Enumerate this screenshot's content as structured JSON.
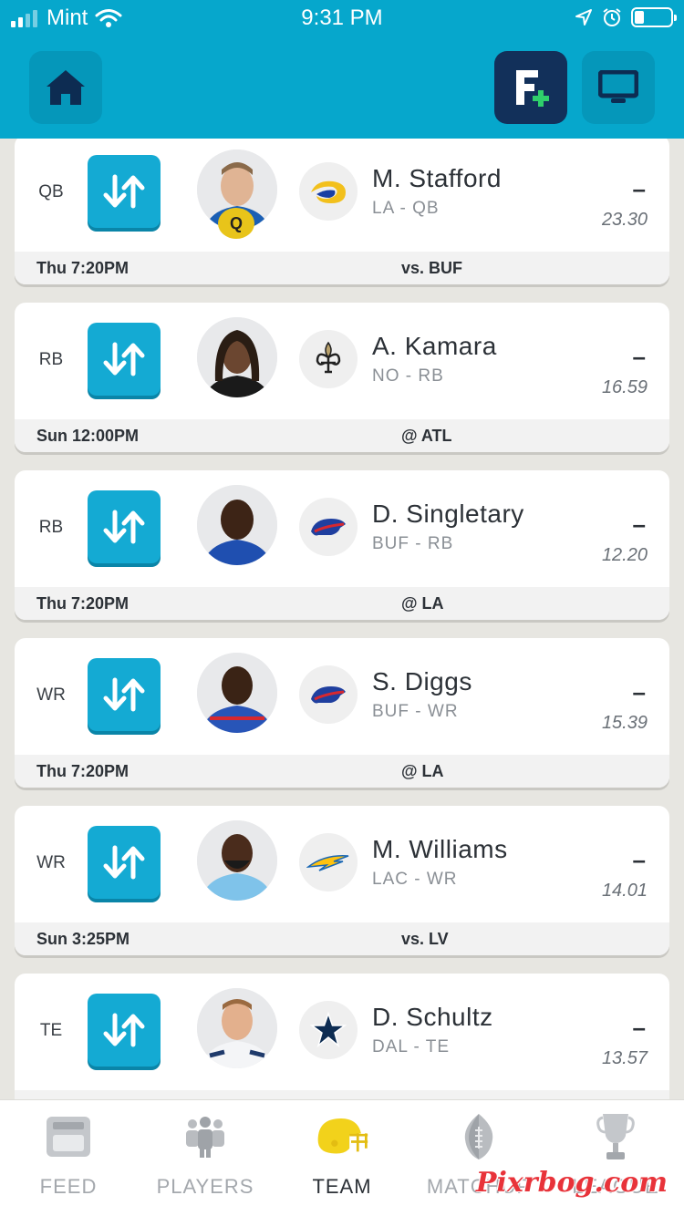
{
  "status": {
    "carrier": "Mint",
    "time": "9:31 PM"
  },
  "players": [
    {
      "pos": "QB",
      "name": "M. Stafford",
      "team": "LA - QB",
      "score": "–",
      "proj": "23.30",
      "game_time": "Thu 7:20PM",
      "opponent": "vs. BUF",
      "badge": "Q",
      "logo": "rams-logo"
    },
    {
      "pos": "RB",
      "name": "A. Kamara",
      "team": "NO - RB",
      "score": "–",
      "proj": "16.59",
      "game_time": "Sun 12:00PM",
      "opponent": "@ ATL",
      "logo": "saints-logo"
    },
    {
      "pos": "RB",
      "name": "D. Singletary",
      "team": "BUF - RB",
      "score": "–",
      "proj": "12.20",
      "game_time": "Thu 7:20PM",
      "opponent": "@ LA",
      "logo": "bills-logo"
    },
    {
      "pos": "WR",
      "name": "S. Diggs",
      "team": "BUF - WR",
      "score": "–",
      "proj": "15.39",
      "game_time": "Thu 7:20PM",
      "opponent": "@ LA",
      "logo": "bills-logo"
    },
    {
      "pos": "WR",
      "name": "M. Williams",
      "team": "LAC - WR",
      "score": "–",
      "proj": "14.01",
      "game_time": "Sun 3:25PM",
      "opponent": "vs. LV",
      "logo": "chargers-logo"
    },
    {
      "pos": "TE",
      "name": "D. Schultz",
      "team": "DAL - TE",
      "score": "–",
      "proj": "13.57",
      "game_time": "",
      "opponent": "",
      "logo": "cowboys-logo"
    }
  ],
  "tabs": [
    {
      "label": "FEED",
      "icon": "feed-icon"
    },
    {
      "label": "PLAYERS",
      "icon": "players-icon"
    },
    {
      "label": "TEAM",
      "icon": "helmet-icon",
      "active": true
    },
    {
      "label": "MATCHUP",
      "icon": "football-icon"
    },
    {
      "label": "LEAGUE",
      "icon": "trophy-icon"
    }
  ],
  "watermark": "Pixrbog.com",
  "colors": {
    "header": "#06a7cc",
    "swap_button": "#14aad3",
    "fplus": "#12305a",
    "team_active": "#f2d21b"
  }
}
